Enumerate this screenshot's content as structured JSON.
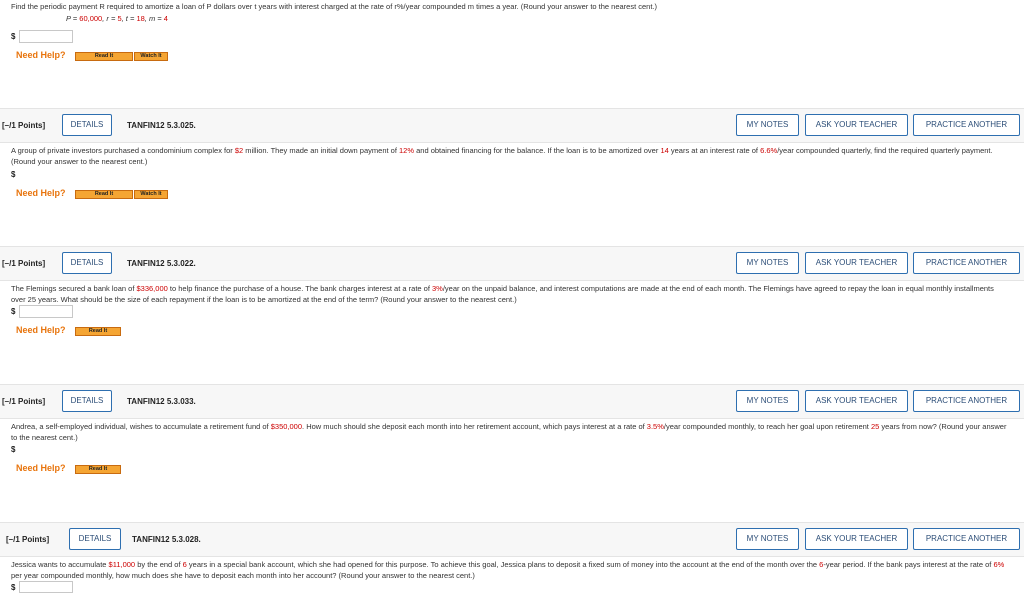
{
  "q0": {
    "text": "Find the periodic payment R required to amortize a loan of P dollars over t years with interest charged at the rate of r%/year compounded m times a year. (Round your answer to the nearest cent.)",
    "formula_parts": [
      "P = ",
      "60,000",
      ", r = ",
      "5",
      ", t = ",
      "18",
      ", m = ",
      "4"
    ],
    "dollar": "$",
    "need_help": "Need Help?",
    "read_it": "Read It",
    "watch_it": "Watch It"
  },
  "questions": [
    {
      "points": "[–/1 Points]",
      "details": "DETAILS",
      "id": "TANFIN12 5.3.025.",
      "my_notes": "MY NOTES",
      "ask_teacher": "ASK YOUR TEACHER",
      "practice": "PRACTICE ANOTHER",
      "text_parts": [
        "A group of private investors purchased a condominium complex for ",
        "$2",
        " million. They made an initial down payment of ",
        "12%",
        " and obtained financing for the balance. If the loan is to be amortized over ",
        "14",
        " years at an interest rate of ",
        "6.6%",
        "/year compounded quarterly, find the required quarterly payment. (Round your answer to the nearest cent.)"
      ],
      "dollar": "$",
      "need_help": "Need Help?",
      "read_it": "Read It",
      "watch_it": "Watch It"
    },
    {
      "points": "[–/1 Points]",
      "details": "DETAILS",
      "id": "TANFIN12 5.3.022.",
      "my_notes": "MY NOTES",
      "ask_teacher": "ASK YOUR TEACHER",
      "practice": "PRACTICE ANOTHER",
      "text_parts": [
        "The Flemings secured a bank loan of ",
        "$336,000",
        " to help finance the purchase of a house. The bank charges interest at a rate of ",
        "3%",
        "/year on the unpaid balance, and interest computations are made at the end of each month. The Flemings have agreed to repay the loan in equal monthly installments over 25 years. What should be the size of each repayment if the loan is to be amortized at the end of the term? (Round your answer to the nearest cent.)"
      ],
      "dollar": "$",
      "need_help": "Need Help?",
      "read_it": "Read It"
    },
    {
      "points": "[–/1 Points]",
      "details": "DETAILS",
      "id": "TANFIN12 5.3.033.",
      "my_notes": "MY NOTES",
      "ask_teacher": "ASK YOUR TEACHER",
      "practice": "PRACTICE ANOTHER",
      "text_parts": [
        "Andrea, a self-employed individual, wishes to accumulate a retirement fund of ",
        "$350,000",
        ". How much should she deposit each month into her retirement account, which pays interest at a rate of ",
        "3.5%",
        "/year compounded monthly, to reach her goal upon retirement ",
        "25",
        " years from now? (Round your answer to the nearest cent.)"
      ],
      "dollar": "$",
      "need_help": "Need Help?",
      "read_it": "Read It"
    },
    {
      "points": "[–/1 Points]",
      "details": "DETAILS",
      "id": "TANFIN12 5.3.028.",
      "my_notes": "MY NOTES",
      "ask_teacher": "ASK YOUR TEACHER",
      "practice": "PRACTICE ANOTHER",
      "text_parts": [
        "Jessica wants to accumulate ",
        "$11,000",
        " by the end of ",
        "6",
        " years in a special bank account, which she had opened for this purpose. To achieve this goal, Jessica plans to deposit a fixed sum of money into the account at the end of the month over the ",
        "6",
        "-year period. If the bank pays interest at the rate of ",
        "6%",
        " per year compounded monthly, how much does she have to deposit each month into her account? (Round your answer to the nearest cent.)"
      ],
      "dollar": "$"
    }
  ],
  "colors": {
    "accent_red": "#cc0000",
    "help_orange": "#e8740c",
    "button_border": "#2e6fb0"
  }
}
